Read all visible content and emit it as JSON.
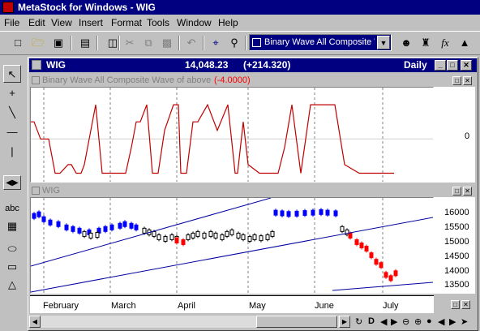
{
  "app": {
    "title": "MetaStock for Windows - WIG"
  },
  "menu": [
    {
      "label": "File"
    },
    {
      "label": "Edit"
    },
    {
      "label": "View"
    },
    {
      "label": "Insert"
    },
    {
      "label": "Format"
    },
    {
      "label": "Tools"
    },
    {
      "label": "Window"
    },
    {
      "label": "Help"
    }
  ],
  "toolbar": {
    "indicator_select": "Binary Wave All  Composite W"
  },
  "chart_window": {
    "title": "WIG",
    "last_value": "14,048.23",
    "change": "(+214.320)",
    "period": "Daily"
  },
  "indicator_panel": {
    "title": "Binary Wave All  Composite Wave of above",
    "value": "(-4.0000)",
    "y_label": "0"
  },
  "price_panel": {
    "title": "WIG",
    "y_ticks": [
      "16000",
      "15500",
      "15000",
      "14500",
      "14000",
      "13500"
    ]
  },
  "x_axis": {
    "months": [
      "February",
      "March",
      "April",
      "May",
      "June",
      "July"
    ]
  },
  "colors": {
    "indicator": "#c00000",
    "trend_line": "#0000a0",
    "up_bar": "#0000ff",
    "down_bar": "#ff0000",
    "neutral_bar": "#000000"
  },
  "chart_data": [
    {
      "type": "line",
      "title": "Binary Wave All  Composite Wave of above",
      "series": [
        {
          "name": "Binary Wave All  Composite Wave of above",
          "x": [
            0,
            4,
            12,
            22,
            30,
            36,
            46,
            50,
            56,
            62,
            66,
            72,
            80,
            88,
            96,
            103,
            112,
            117,
            124,
            130,
            135,
            143,
            150,
            157,
            165,
            176,
            182,
            185,
            192,
            200,
            206,
            218,
            230,
            243,
            252,
            255,
            262,
            268,
            282,
            290,
            296,
            305,
            313,
            322,
            333,
            345,
            360,
            375,
            387,
            405,
            418,
            430,
            448
          ],
          "values": [
            2,
            2,
            0,
            0,
            -4,
            -4,
            -3,
            -3,
            -4,
            -4,
            -3,
            0,
            4,
            -4,
            -4,
            -4,
            -4,
            -4,
            -1,
            2,
            2,
            4,
            -4,
            -4,
            1,
            4,
            4,
            -4,
            -4,
            2,
            2,
            4,
            1,
            4,
            -4,
            -4,
            2,
            -3,
            -4,
            -4,
            -4,
            -4,
            -1,
            4,
            -4,
            4,
            4,
            4,
            -3,
            -4,
            -4,
            -4,
            -4
          ]
        }
      ],
      "ylim": [
        -5,
        6
      ]
    },
    {
      "type": "candlestick",
      "title": "WIG",
      "ylim": [
        13350,
        16250
      ],
      "y_ticks": [
        13500,
        14000,
        14500,
        15000,
        15500,
        16000
      ],
      "series": [
        {
          "name": "blue",
          "points": [
            [
              4,
              15700
            ],
            [
              10,
              15750
            ],
            [
              16,
              15600
            ],
            [
              24,
              15500
            ],
            [
              34,
              15450
            ],
            [
              44,
              15350
            ],
            [
              52,
              15300
            ],
            [
              60,
              15250
            ],
            [
              72,
              15200
            ],
            [
              84,
              15250
            ],
            [
              92,
              15300
            ],
            [
              100,
              15350
            ],
            [
              110,
              15400
            ],
            [
              116,
              15450
            ],
            [
              124,
              15400
            ],
            [
              130,
              15350
            ],
            [
              302,
              15800
            ],
            [
              310,
              15780
            ],
            [
              318,
              15760
            ],
            [
              328,
              15770
            ],
            [
              338,
              15790
            ],
            [
              348,
              15800
            ],
            [
              358,
              15820
            ],
            [
              366,
              15800
            ],
            [
              376,
              15780
            ]
          ]
        },
        {
          "name": "black",
          "points": [
            [
              66,
              15150
            ],
            [
              74,
              15100
            ],
            [
              82,
              15120
            ],
            [
              140,
              15250
            ],
            [
              146,
              15200
            ],
            [
              152,
              15150
            ],
            [
              158,
              15050
            ],
            [
              166,
              15000
            ],
            [
              174,
              15050
            ],
            [
              180,
              15000
            ],
            [
              194,
              15050
            ],
            [
              200,
              15100
            ],
            [
              206,
              15150
            ],
            [
              214,
              15100
            ],
            [
              222,
              15150
            ],
            [
              228,
              15100
            ],
            [
              236,
              15050
            ],
            [
              242,
              15150
            ],
            [
              248,
              15200
            ],
            [
              256,
              15100
            ],
            [
              262,
              15050
            ],
            [
              270,
              15000
            ],
            [
              276,
              15050
            ],
            [
              284,
              15020
            ],
            [
              292,
              15050
            ],
            [
              298,
              15150
            ],
            [
              384,
              15300
            ],
            [
              390,
              15200
            ]
          ]
        },
        {
          "name": "red",
          "points": [
            [
              180,
              14950
            ],
            [
              188,
              14900
            ],
            [
              394,
              15100
            ],
            [
              402,
              14900
            ],
            [
              408,
              14800
            ],
            [
              414,
              14700
            ],
            [
              420,
              14500
            ],
            [
              426,
              14300
            ],
            [
              432,
              14200
            ],
            [
              438,
              13900
            ],
            [
              444,
              13800
            ],
            [
              450,
              13950
            ]
          ]
        }
      ]
    }
  ]
}
